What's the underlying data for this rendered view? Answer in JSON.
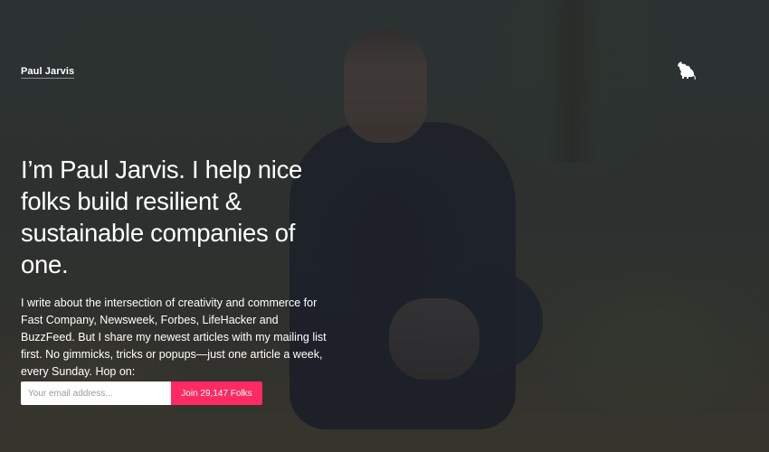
{
  "header": {
    "site_name": "Paul Jarvis",
    "mascot_icon": "rat-silhouette-icon"
  },
  "hero": {
    "headline": "I’m Paul Jarvis. I help nice folks build resilient & sustainable companies of one.",
    "body": "I write about the intersection of creativity and commerce for Fast Company, Newsweek, Forbes, LifeHacker and BuzzFeed. But I share my newest articles with my mailing list first. No gimmicks, tricks or popups—just one article a week, every Sunday. Hop on:"
  },
  "signup": {
    "email_placeholder": "Your email address...",
    "email_value": "",
    "button_label": "Join 29,147 Folks"
  },
  "colors": {
    "accent": "#ff2a63",
    "text": "#ffffff"
  }
}
